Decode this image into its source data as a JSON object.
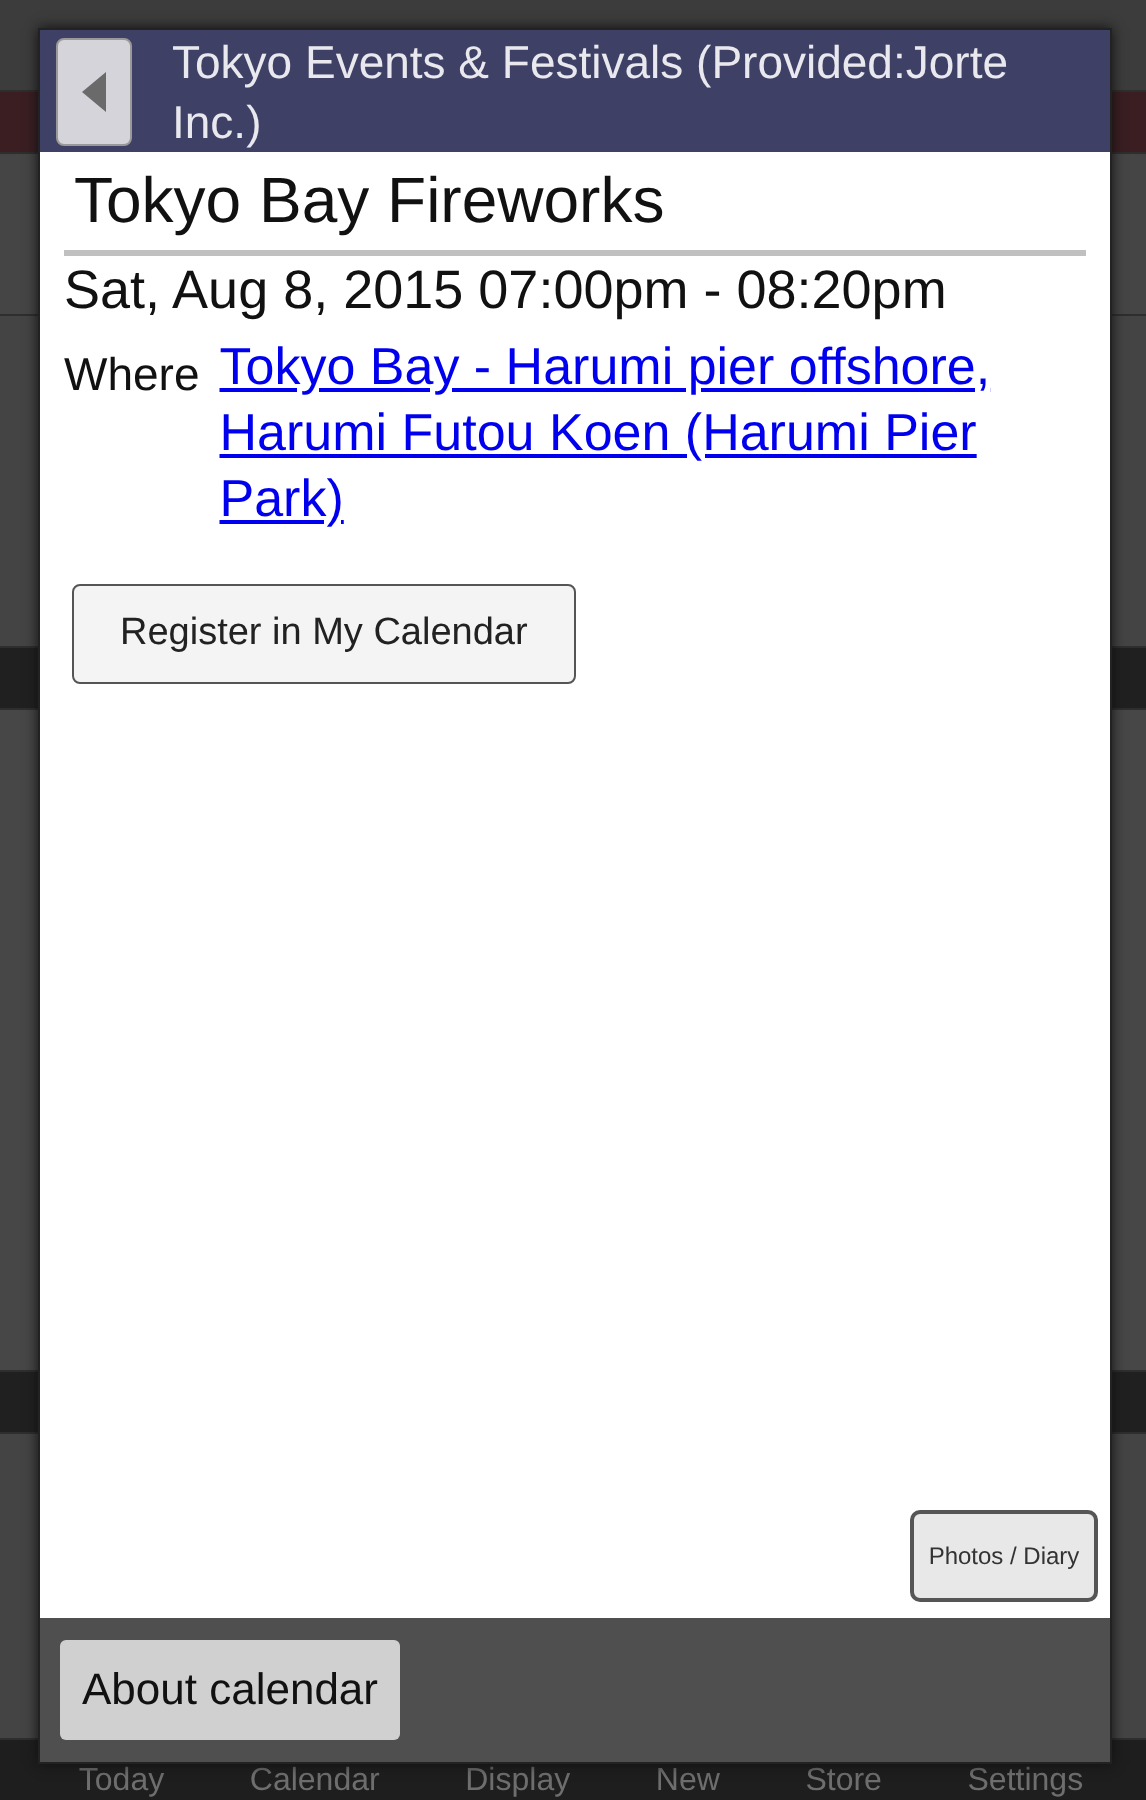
{
  "dialog": {
    "title": "Tokyo Events & Festivals (Provided:Jorte Inc.)",
    "event_title": "Tokyo Bay Fireworks",
    "datetime": "Sat, Aug 8, 2015 07:00pm - 08:20pm",
    "where_label": "Where",
    "where_link": "Tokyo Bay - Harumi pier offshore, Harumi Futou Koen (Harumi Pier Park)",
    "register_button": "Register in My Calendar",
    "photos_button": "Photos / Diary",
    "about_button": "About calendar"
  },
  "bottom_nav": [
    {
      "label": "Today"
    },
    {
      "label": "Calendar"
    },
    {
      "label": "Display"
    },
    {
      "label": "New"
    },
    {
      "label": "Store"
    },
    {
      "label": "Settings"
    }
  ]
}
